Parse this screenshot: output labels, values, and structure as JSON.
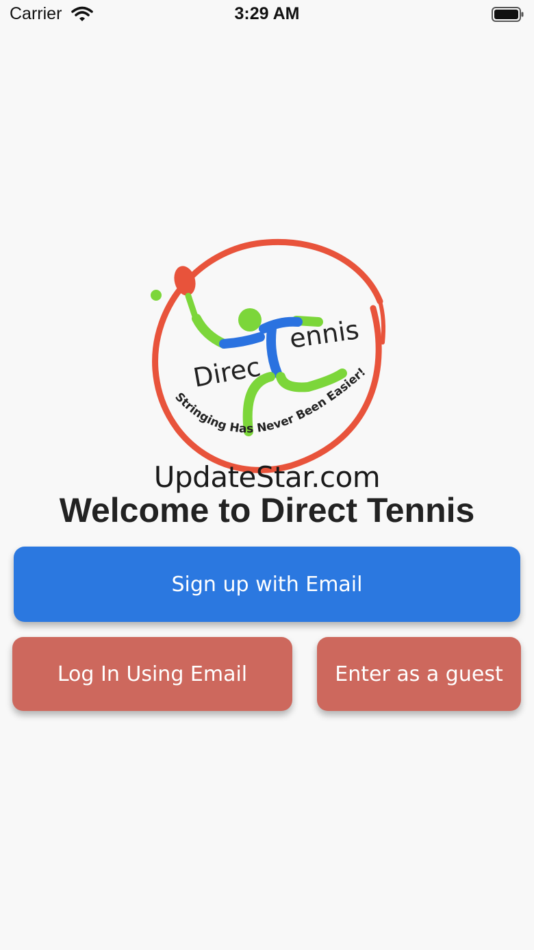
{
  "status_bar": {
    "carrier": "Carrier",
    "time": "3:29 AM"
  },
  "logo": {
    "brand_left": "Direc",
    "brand_right": "ennis",
    "tagline": "Stringing Has Never Been Easier!",
    "colors": {
      "ring": "#e8533b",
      "figure_green": "#7cd63a",
      "figure_blue": "#2a72e0"
    }
  },
  "watermark": "UpdateStar.com",
  "welcome_title": "Welcome to Direct Tennis",
  "buttons": {
    "signup": "Sign up with Email",
    "login": "Log In Using Email",
    "guest": "Enter as a guest"
  },
  "colors": {
    "primary": "#2b78e0",
    "secondary": "#cd685d",
    "background": "#f8f8f8"
  }
}
